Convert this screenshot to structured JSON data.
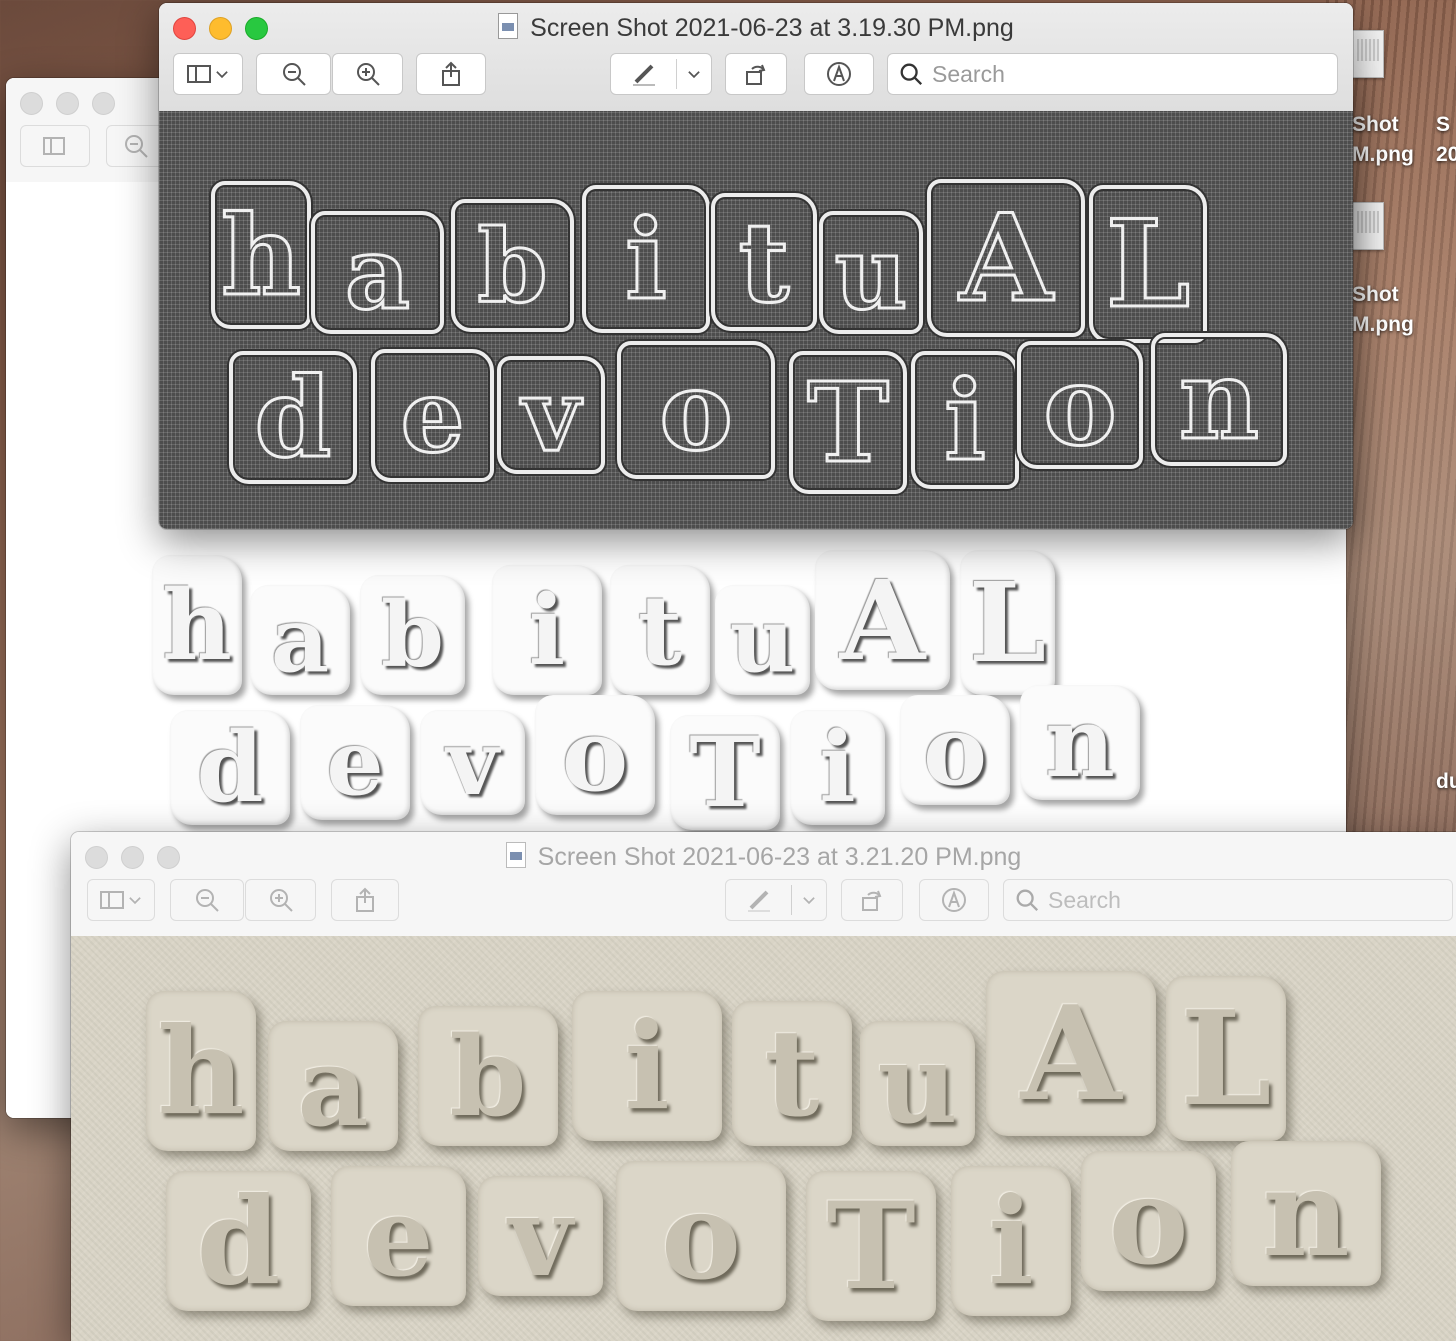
{
  "desktop": {
    "files": [
      {
        "line1": "Shot",
        "line2": "M.png"
      },
      {
        "line1": "S",
        "line2": "20"
      },
      {
        "line1": "Shot",
        "line2": "M.png"
      },
      {
        "line1": "du",
        "line2": ""
      }
    ]
  },
  "windows": {
    "front": {
      "title": "Screen Shot 2021-06-23 at 3.19.30 PM.png",
      "search_placeholder": "Search"
    },
    "back": {
      "title": "Screen Shot 2021-06-23 at 3.21.20 PM.png",
      "search_placeholder": "Search"
    }
  },
  "artwork": {
    "line1": [
      "h",
      "a",
      "b",
      "i",
      "t",
      "u",
      "A",
      "L"
    ],
    "line2": [
      "d",
      "e",
      "v",
      "o",
      "T",
      "i",
      "o",
      "n"
    ],
    "text": "habituAL devoTion"
  },
  "icons": [
    "sidebar-icon",
    "chevron-down-icon",
    "zoom-out-icon",
    "zoom-in-icon",
    "share-icon",
    "markup-pen-icon",
    "rotate-icon",
    "annotate-icon",
    "search-icon"
  ]
}
